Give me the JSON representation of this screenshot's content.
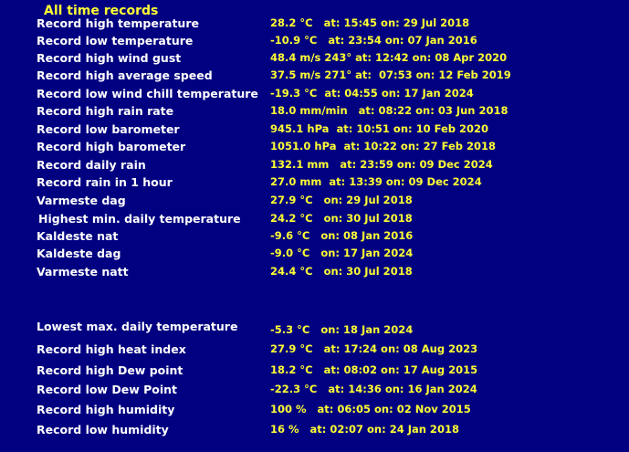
{
  "title": "All time records",
  "colors": {
    "background": "#000080",
    "label": "#ffffff",
    "value": "#ffff33"
  },
  "records": [
    {
      "label": "Record high temperature",
      "value": "28.2 °C   at: 15:45 on: 29 Jul 2018"
    },
    {
      "label": "Record low temperature",
      "value": "-10.9 °C   at: 23:54 on: 07 Jan 2016"
    },
    {
      "label": "Record high wind gust",
      "value": "48.4 m/s 243° at: 12:42 on: 08 Apr 2020"
    },
    {
      "label": "Record high average speed",
      "value": "37.5 m/s 271° at:  07:53 on: 12 Feb 2019"
    },
    {
      "label": "Record low wind chill temperature",
      "value": "-19.3 °C  at: 04:55 on: 17 Jan 2024"
    },
    {
      "label": "Record high rain rate",
      "value": "18.0 mm/min   at: 08:22 on: 03 Jun 2018"
    },
    {
      "label": "Record low barometer",
      "value": "945.1 hPa  at: 10:51 on: 10 Feb 2020"
    },
    {
      "label": "Record high barometer",
      "value": "1051.0 hPa  at: 10:22 on: 27 Feb 2018"
    },
    {
      "label": "Record daily rain",
      "value": "132.1 mm   at: 23:59 on: 09 Dec 2024"
    },
    {
      "label": "Record rain in 1 hour",
      "value": "27.0 mm  at: 13:39 on: 09 Dec 2024"
    },
    {
      "label": "Varmeste dag",
      "value": "27.9 °C   on: 29 Jul 2018"
    },
    {
      "label": "Highest min. daily temperature",
      "value": "24.2 °C   on: 30 Jul 2018"
    },
    {
      "label": "Kaldeste nat",
      "value": "-9.6 °C   on: 08 Jan 2016"
    },
    {
      "label": "Kaldeste dag",
      "value": "-9.0 °C   on: 17 Jan 2024"
    },
    {
      "label": "Varmeste natt",
      "value": "24.4 °C   on: 30 Jul 2018"
    },
    {
      "label": "Lowest max. daily temperature",
      "value": "-5.3 °C   on: 18 Jan 2024"
    },
    {
      "label": "Record high heat index",
      "value": "27.9 °C   at: 17:24 on: 08 Aug 2023"
    },
    {
      "label": "Record high Dew point",
      "value": "18.2 °C   at: 08:02 on: 17 Aug 2015"
    },
    {
      "label": "Record low Dew Point",
      "value": "-22.3 °C   at: 14:36 on: 16 Jan 2024"
    },
    {
      "label": "Record high humidity",
      "value": "100 %   at: 06:05 on: 02 Nov 2015"
    },
    {
      "label": "Record low humidity",
      "value": "16 %   at: 02:07 on: 24 Jan 2018"
    }
  ]
}
